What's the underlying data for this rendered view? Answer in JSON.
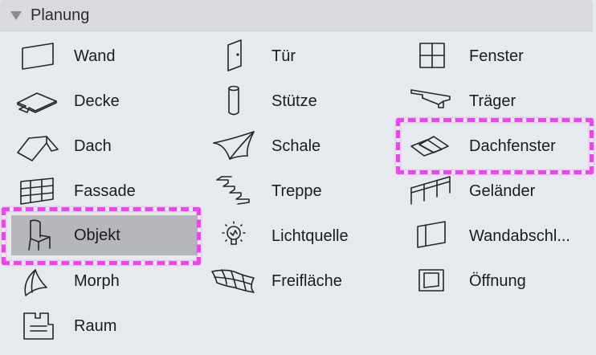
{
  "section": {
    "title": "Planung",
    "expanded_icon": "disclosure-triangle-down-icon"
  },
  "tools": [
    {
      "label": "Wand",
      "icon": "wall-icon"
    },
    {
      "label": "Tür",
      "icon": "door-icon"
    },
    {
      "label": "Fenster",
      "icon": "window-icon"
    },
    {
      "label": "Decke",
      "icon": "slab-icon"
    },
    {
      "label": "Stütze",
      "icon": "column-icon"
    },
    {
      "label": "Träger",
      "icon": "beam-icon"
    },
    {
      "label": "Dach",
      "icon": "roof-icon"
    },
    {
      "label": "Schale",
      "icon": "shell-icon"
    },
    {
      "label": "Dachfenster",
      "icon": "skylight-icon"
    },
    {
      "label": "Fassade",
      "icon": "curtain-wall-icon"
    },
    {
      "label": "Treppe",
      "icon": "stair-icon"
    },
    {
      "label": "Geländer",
      "icon": "railing-icon"
    },
    {
      "label": "Objekt",
      "icon": "chair-object-icon",
      "selected": true
    },
    {
      "label": "Lichtquelle",
      "icon": "lightbulb-icon"
    },
    {
      "label": "Wandabschl...",
      "icon": "wall-end-icon"
    },
    {
      "label": "Morph",
      "icon": "morph-icon"
    },
    {
      "label": "Freifläche",
      "icon": "mesh-icon"
    },
    {
      "label": "Öffnung",
      "icon": "opening-icon"
    },
    {
      "label": "Raum",
      "icon": "zone-icon"
    }
  ],
  "colors": {
    "panel_bg": "#e6e9ed",
    "header_bg": "#d8dade",
    "selected_bg": "#b6b7ba",
    "highlight": "#e64ae6"
  }
}
